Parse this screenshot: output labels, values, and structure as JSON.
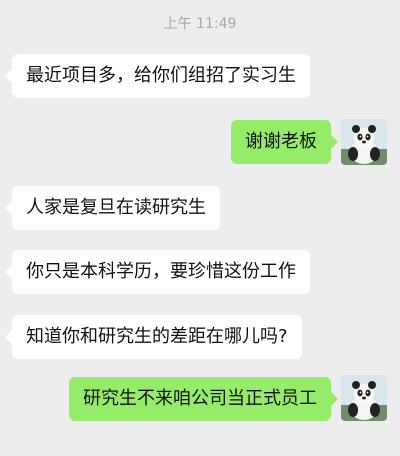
{
  "chat": {
    "timestamp": "上午 11:49",
    "messages": [
      {
        "side": "left",
        "text": "最近项目多，给你们组招了实习生"
      },
      {
        "side": "right",
        "text": "谢谢老板",
        "avatar": "panda-avatar"
      },
      {
        "side": "left",
        "text": "人家是复旦在读研究生"
      },
      {
        "side": "left",
        "text": "你只是本科学历，要珍惜这份工作"
      },
      {
        "side": "left",
        "text": "知道你和研究生的差距在哪儿吗?"
      },
      {
        "side": "right",
        "text": "研究生不来咱公司当正式员工",
        "avatar": "panda-avatar"
      }
    ]
  },
  "colors": {
    "background": "#ededed",
    "incoming_bubble": "#ffffff",
    "outgoing_bubble": "#95ec69",
    "timestamp_text": "#a8a8a8"
  }
}
